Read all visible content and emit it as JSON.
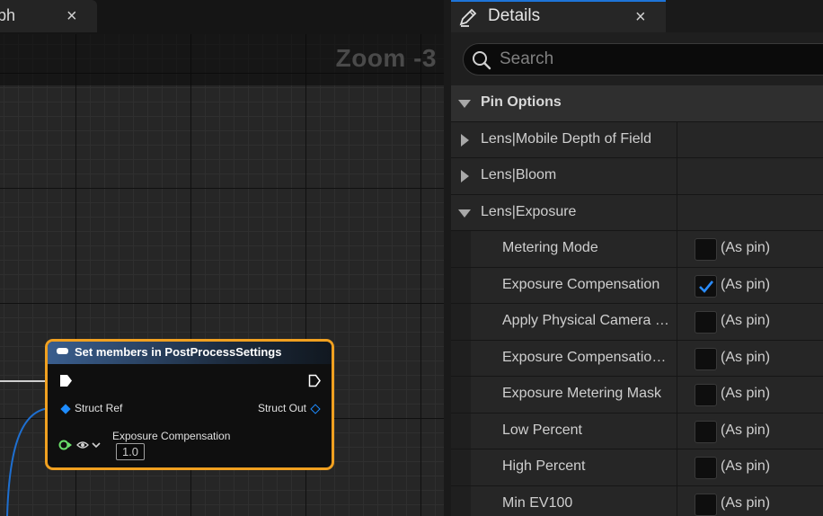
{
  "graph": {
    "tab_label": "ph",
    "tab_close": "×",
    "zoom": "Zoom -3",
    "node": {
      "title": "Set members in PostProcessSettings",
      "struct_ref": "Struct Ref",
      "struct_out": "Struct Out",
      "exposure_label": "Exposure Compensation",
      "exposure_value": "1.0"
    }
  },
  "details": {
    "tab_label": "Details",
    "tab_close": "×",
    "search_placeholder": "Search",
    "section": "Pin Options",
    "categories": [
      {
        "label": "Lens|Mobile Depth of Field",
        "expanded": false
      },
      {
        "label": "Lens|Bloom",
        "expanded": false
      },
      {
        "label": "Lens|Exposure",
        "expanded": true
      }
    ],
    "properties": [
      {
        "name": "Metering Mode",
        "checked": false,
        "value": "(As pin)"
      },
      {
        "name": "Exposure Compensation",
        "checked": true,
        "value": "(As pin)"
      },
      {
        "name": "Apply Physical Camera E…",
        "checked": false,
        "value": "(As pin)"
      },
      {
        "name": "Exposure Compensation…",
        "checked": false,
        "value": "(As pin)"
      },
      {
        "name": "Exposure Metering Mask",
        "checked": false,
        "value": "(As pin)"
      },
      {
        "name": "Low Percent",
        "checked": false,
        "value": "(As pin)"
      },
      {
        "name": "High Percent",
        "checked": false,
        "value": "(As pin)"
      },
      {
        "name": "Min EV100",
        "checked": false,
        "value": "(As pin)"
      }
    ]
  },
  "colors": {
    "accent": "#1e74d8",
    "node_border": "#f0a020",
    "struct_pin": "#1e8cff",
    "checkmark": "#2a8cff"
  }
}
